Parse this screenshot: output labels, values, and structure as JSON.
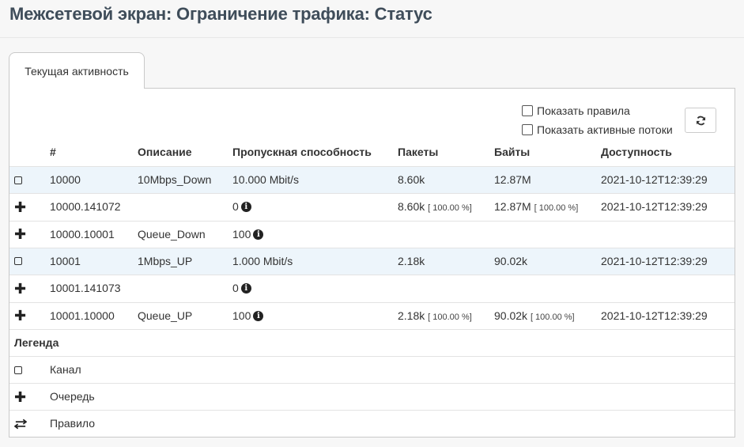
{
  "page_title": "Межсетевой экран: Ограничение трафика: Статус",
  "tab": {
    "label": "Текущая активность"
  },
  "options": {
    "show_rules": "Показать правила",
    "show_active_flows": "Показать активные потоки"
  },
  "refresh_icon": "refresh-icon",
  "table": {
    "headers": {
      "id": "#",
      "description": "Описание",
      "bandwidth": "Пропускная способность",
      "packets": "Пакеты",
      "bytes": "Байты",
      "accessed": "Доступность"
    },
    "rows": [
      {
        "type": "pipe",
        "icon": "pipe-icon",
        "id": "10000",
        "description": "10Mbps_Down",
        "bandwidth": "10.000 Mbit/s",
        "packets": "8.60k",
        "packets_pct": "",
        "bytes": "12.87M",
        "bytes_pct": "",
        "accessed": "2021-10-12T12:39:29",
        "info": false
      },
      {
        "type": "queue",
        "icon": "queue-plus-icon",
        "id": "10000.141072",
        "description": "",
        "bandwidth": "0",
        "packets": "8.60k",
        "packets_pct": "[ 100.00 %]",
        "bytes": "12.87M",
        "bytes_pct": "[ 100.00 %]",
        "accessed": "2021-10-12T12:39:29",
        "info": true
      },
      {
        "type": "queue",
        "icon": "queue-plus-icon",
        "id": "10000.10001",
        "description": "Queue_Down",
        "bandwidth": "100",
        "packets": "",
        "packets_pct": "",
        "bytes": "",
        "bytes_pct": "",
        "accessed": "",
        "info": true
      },
      {
        "type": "pipe",
        "icon": "pipe-icon",
        "id": "10001",
        "description": "1Mbps_UP",
        "bandwidth": "1.000 Mbit/s",
        "packets": "2.18k",
        "packets_pct": "",
        "bytes": "90.02k",
        "bytes_pct": "",
        "accessed": "2021-10-12T12:39:29",
        "info": false
      },
      {
        "type": "queue",
        "icon": "queue-plus-icon",
        "id": "10001.141073",
        "description": "",
        "bandwidth": "0",
        "packets": "",
        "packets_pct": "",
        "bytes": "",
        "bytes_pct": "",
        "accessed": "",
        "info": true
      },
      {
        "type": "queue",
        "icon": "queue-plus-icon",
        "id": "10001.10000",
        "description": "Queue_UP",
        "bandwidth": "100",
        "packets": "2.18k",
        "packets_pct": "[ 100.00 %]",
        "bytes": "90.02k",
        "bytes_pct": "[ 100.00 %]",
        "accessed": "2021-10-12T12:39:29",
        "info": true
      }
    ]
  },
  "legend": {
    "title": "Легенда",
    "items": [
      {
        "icon": "pipe-icon",
        "label": "Канал"
      },
      {
        "icon": "queue-plus-icon",
        "label": "Очередь"
      },
      {
        "icon": "rule-exchange-icon",
        "label": "Правило"
      }
    ]
  }
}
